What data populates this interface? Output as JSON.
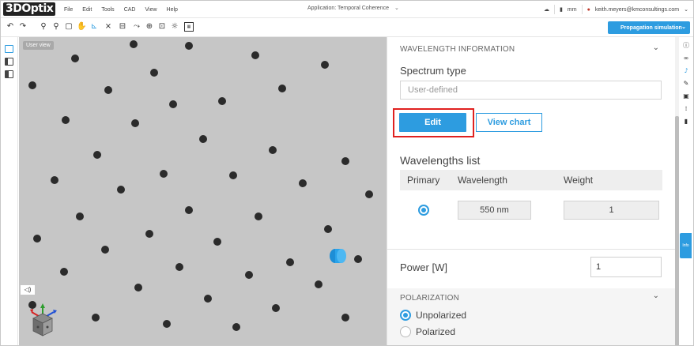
{
  "app": {
    "logo": "3DOptix",
    "menus": [
      "File",
      "Edit",
      "Tools",
      "CAD",
      "View",
      "Help"
    ],
    "application_title": "Application: Temporal Coherence",
    "units": "mm",
    "user_email": "keith.meyers@kmconsultings.com"
  },
  "toolbar": {
    "propagation_label": "Propagation simulation"
  },
  "viewport": {
    "view_label": "User view"
  },
  "panel": {
    "wavelength_section": "WAVELENGTH INFORMATION",
    "spectrum_label": "Spectrum type",
    "spectrum_placeholder": "User-defined",
    "edit_label": "Edit",
    "view_chart_label": "View chart",
    "wavelengths_list_label": "Wavelengths list",
    "table_headers": {
      "primary": "Primary",
      "wavelength": "Wavelength",
      "weight": "Weight"
    },
    "row": {
      "wavelength": "550 nm",
      "weight": "1"
    },
    "power_label": "Power [W]",
    "power_value": "1",
    "polarization_section": "POLARIZATION",
    "unpolarized_label": "Unpolarized",
    "polarized_label": "Polarized"
  },
  "info_tab": "Info",
  "colors": {
    "accent": "#2d9ce0",
    "highlight": "#e0211f",
    "viewport_bg": "#c6c6c6"
  }
}
